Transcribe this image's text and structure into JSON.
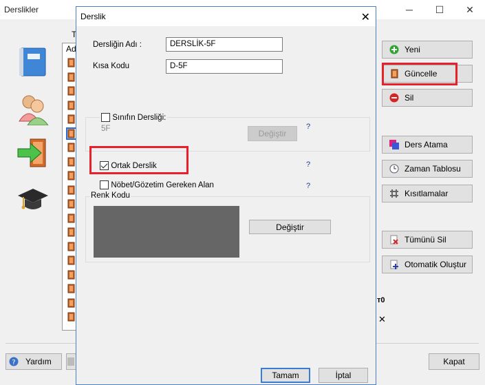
{
  "main": {
    "title": "Derslikler",
    "tab_header": "Ta",
    "list_header": "Ad",
    "buttons": {
      "new": "Yeni",
      "update": "Güncelle",
      "delete": "Sil",
      "lesson_assign": "Ders Atama",
      "timetable": "Zaman Tablosu",
      "restrictions": "Kısıtlamalar",
      "delete_all": "Tümünü Sil",
      "auto_create": "Otomatik Oluştur",
      "help": "Yardım",
      "close": "Kapat"
    },
    "fragment_key": "т0",
    "fragment_x": "✕"
  },
  "dialog": {
    "title": "Derslik",
    "name_label": "Dersliğin Adı :",
    "name_value": "DERSLİK-5F",
    "short_label": "Kısa Kodu",
    "short_value": "D-5F",
    "class_room_label": "Sınıfın Dersliği:",
    "class_room_value": "5F",
    "change1": "Değiştir",
    "shared_label": "Ortak Derslik",
    "duty_label": "Nöbet/Gözetim Gereken Alan",
    "color_label": "Renk Kodu",
    "color_value": "#666666",
    "change2": "Değiştir",
    "q": "?",
    "ok": "Tamam",
    "cancel": "İptal",
    "close_x": "✕"
  }
}
